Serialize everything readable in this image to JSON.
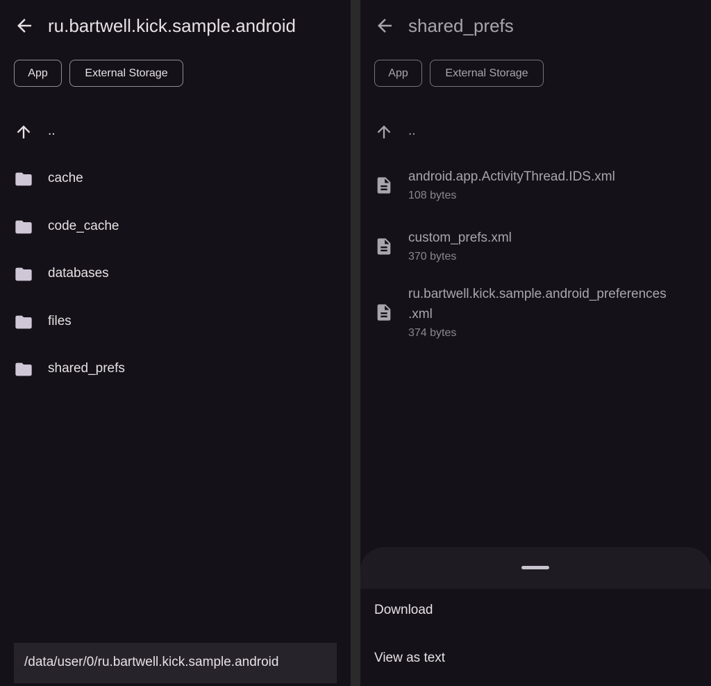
{
  "left": {
    "title": "ru.bartwell.kick.sample.android",
    "chips": [
      "App",
      "External Storage"
    ],
    "parent_label": "..",
    "folders": [
      "cache",
      "code_cache",
      "databases",
      "files",
      "shared_prefs"
    ],
    "path": "/data/user/0/ru.bartwell.kick.sample.android"
  },
  "right": {
    "title": "shared_prefs",
    "chips": [
      "App",
      "External Storage"
    ],
    "parent_label": "..",
    "files": [
      {
        "name_lines": [
          "android.app.ActivityThread.IDS.xml"
        ],
        "size": "108 bytes"
      },
      {
        "name_lines": [
          "custom_prefs.xml"
        ],
        "size": "370 bytes"
      },
      {
        "name_lines": [
          "ru.bartwell.kick.sample.android_preferences",
          ".xml"
        ],
        "size": "374 bytes"
      }
    ],
    "sheet_actions": [
      "Download",
      "View as text"
    ]
  },
  "icons": {
    "back": "arrow-left-icon",
    "up": "arrow-up-icon",
    "folder": "folder-icon",
    "file": "document-icon"
  },
  "colors": {
    "background": "#141218",
    "text": "#e6e1e5",
    "text_dimmed": "#a9a5ac",
    "chip_border": "#938f99",
    "path_bar": "#26232b",
    "sheet": "#1e1c22",
    "folder_icon": "#cfc6d6"
  }
}
